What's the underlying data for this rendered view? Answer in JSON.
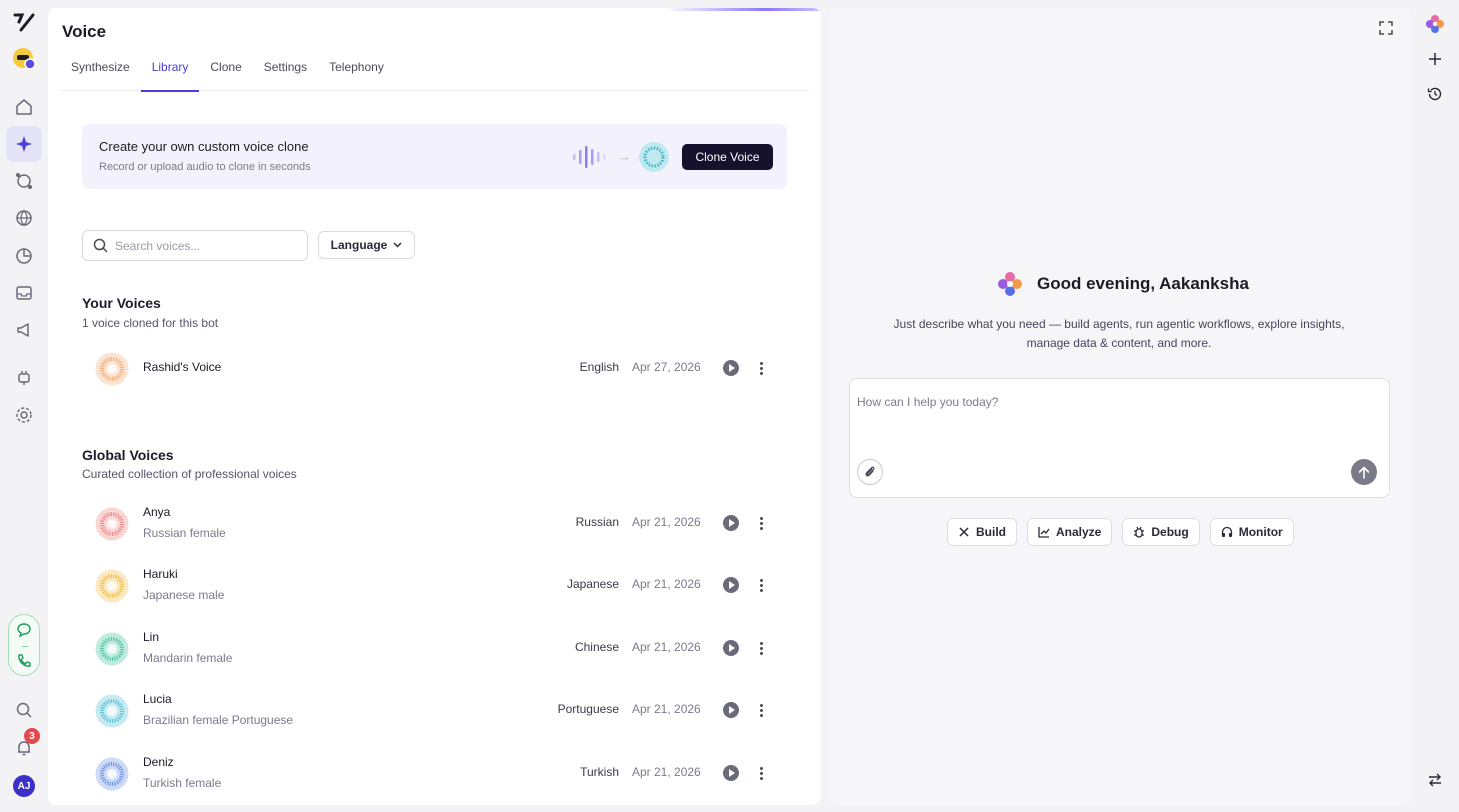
{
  "app": {
    "logo": "Y",
    "avatar_initials": "AJ",
    "notification_count": "3"
  },
  "page": {
    "title": "Voice"
  },
  "tabs": [
    {
      "label": "Synthesize"
    },
    {
      "label": "Library"
    },
    {
      "label": "Clone"
    },
    {
      "label": "Settings"
    },
    {
      "label": "Telephony"
    }
  ],
  "banner": {
    "title": "Create your own custom voice clone",
    "subtitle": "Record or upload audio to clone in seconds",
    "button_label": "Clone Voice"
  },
  "search": {
    "placeholder": "Search voices..."
  },
  "language_filter": {
    "label": "Language"
  },
  "your_voices": {
    "title": "Your Voices",
    "subtitle": "1 voice cloned for this bot",
    "items": [
      {
        "name": "Rashid's Voice",
        "description": "",
        "language": "English",
        "date": "Apr 27, 2026",
        "color": "#f3b07a"
      }
    ]
  },
  "global_voices": {
    "title": "Global Voices",
    "subtitle": "Curated collection of professional voices",
    "items": [
      {
        "name": "Anya",
        "description": "Russian female",
        "language": "Russian",
        "date": "Apr 21, 2026",
        "color": "#ee8a8a"
      },
      {
        "name": "Haruki",
        "description": "Japanese male",
        "language": "Japanese",
        "date": "Apr 21, 2026",
        "color": "#f0c04a"
      },
      {
        "name": "Lin",
        "description": "Mandarin female",
        "language": "Chinese",
        "date": "Apr 21, 2026",
        "color": "#4fc7a3"
      },
      {
        "name": "Lucia",
        "description": "Brazilian female Portuguese",
        "language": "Portuguese",
        "date": "Apr 21, 2026",
        "color": "#5cc3d6"
      },
      {
        "name": "Deniz",
        "description": "Turkish female",
        "language": "Turkish",
        "date": "Apr 21, 2026",
        "color": "#6f95e6"
      }
    ]
  },
  "assistant": {
    "greeting": "Good evening, Aakanksha",
    "description": "Just describe what you need — build agents, run agentic workflows, explore insights, manage data & content, and more.",
    "input_placeholder": "How can I help you today?",
    "chips": [
      {
        "label": "Build",
        "icon": "tools-icon"
      },
      {
        "label": "Analyze",
        "icon": "chart-line-icon"
      },
      {
        "label": "Debug",
        "icon": "bug-icon"
      },
      {
        "label": "Monitor",
        "icon": "headphones-icon"
      }
    ]
  },
  "colors": {
    "accent": "#4a3fd6",
    "banner_bg": "#f3f1fb",
    "dark_button": "#16122e"
  }
}
